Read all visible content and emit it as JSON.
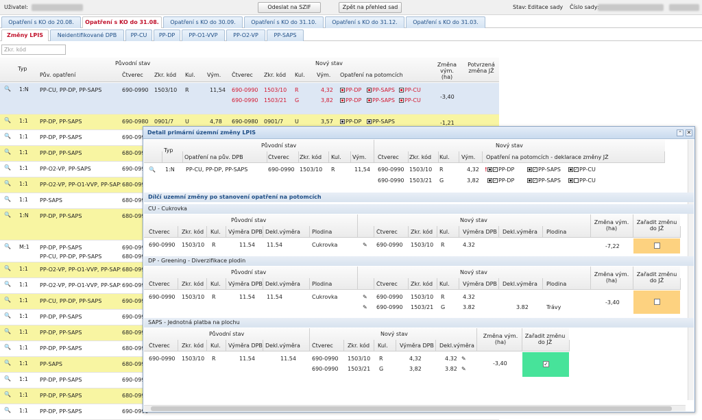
{
  "topbar": {
    "user_label": "Uživatel:",
    "send_button": "Odeslat na SZIF",
    "back_button": "Zpět na přehled sad",
    "state_label": "Stav:",
    "state_value": "Editace sady",
    "set_label": "Číslo sady:"
  },
  "tabs_top": [
    "Opatření s KO do 20.08.",
    "Opatření s KO do 31.08.",
    "Opatření s KO do 30.09.",
    "Opatření s KO do 31.10.",
    "Opatření s KO do 31.12.",
    "Opatření s KO do 31.03."
  ],
  "tabs_sub": [
    "Změny LPIS",
    "Neidentifikované DPB",
    "PP-CU",
    "PP-DP",
    "PP-O1-VVP",
    "PP-O2-VP",
    "PP-SAPS"
  ],
  "filter_placeholder": "Zkr. kód",
  "grid": {
    "headers": {
      "typ": "Typ",
      "puvodni": "Původní stav",
      "novy": "Nový stav",
      "zmena": "Změna vým. (ha)",
      "potvrzena": "Potvrzená změna JŽ",
      "puv_opatreni": "Pův. opatření",
      "ctverec": "Čtverec",
      "zkr": "Zkr. kód",
      "kul": "Kul.",
      "vym": "Vým.",
      "ctverec2": "Čtverec",
      "zkr2": "Zkr. kód",
      "kul2": "Kul.",
      "vym2": "Vým.",
      "op_potomci": "Opatření na potomcích"
    },
    "rows": [
      {
        "typ": "1:N",
        "opat": "PP-CU, PP-DP, PP-SAPS",
        "ctv": "690-0990",
        "zkr": "1503/10",
        "kul": "R",
        "vym": "11,54",
        "new": [
          [
            "690-0990",
            "1503/10",
            "R",
            "4,32"
          ],
          [
            "690-0990",
            "1503/21",
            "G",
            "3,82"
          ]
        ],
        "pot": [
          [
            "PP-DP",
            "PP-SAPS",
            "PP-CU"
          ],
          [
            "PP-DP",
            "PP-SAPS",
            "PP-CU"
          ]
        ],
        "zmena": "-3,40"
      },
      {
        "typ": "1:1",
        "opat": "PP-DP, PP-SAPS",
        "ctv": "690-0980",
        "zkr": "0901/7",
        "kul": "U",
        "vym": "4,78",
        "new": [
          [
            "690-0980",
            "0901/7",
            "U",
            "3,57"
          ]
        ],
        "pot": [
          [
            "PP-DP",
            "PP-SAPS"
          ]
        ],
        "zmena": "-1,21"
      },
      {
        "typ": "1:1",
        "opat": "PP-DP, PP-SAPS",
        "ctv": "690-0990"
      },
      {
        "typ": "1:1",
        "opat": "PP-DP, PP-SAPS",
        "ctv": "680-0990"
      },
      {
        "typ": "1:1",
        "opat": "PP-O2-VP, PP-SAPS",
        "ctv": "690-0990"
      },
      {
        "typ": "1:1",
        "opat": "PP-O2-VP, PP-O1-VVP, PP-SAPS",
        "ctv": "680-0990"
      },
      {
        "typ": "1:1",
        "opat": "PP-SAPS",
        "ctv": "680-0990"
      },
      {
        "typ": "1:N",
        "opat": "PP-DP, PP-SAPS",
        "ctv": "680-0990"
      },
      {
        "typ": "M:1",
        "opat": "PP-DP, PP-SAPS",
        "opat2": "PP-CU, PP-DP, PP-SAPS",
        "ctv": "690-0990",
        "ctv2": "680-0990"
      },
      {
        "typ": "1:1",
        "opat": "PP-O2-VP, PP-O1-VVP, PP-SAPS",
        "ctv": "680-0990"
      },
      {
        "typ": "1:1",
        "opat": "PP-O2-VP, PP-O1-VVP, PP-SAPS",
        "ctv": "690-0990"
      },
      {
        "typ": "1:1",
        "opat": "PP-CU, PP-DP, PP-SAPS",
        "ctv": "690-0990"
      },
      {
        "typ": "1:1",
        "opat": "PP-DP, PP-SAPS",
        "ctv": "690-0990"
      },
      {
        "typ": "1:1",
        "opat": "PP-DP, PP-SAPS",
        "ctv": "680-0990"
      },
      {
        "typ": "1:1",
        "opat": "PP-DP, PP-SAPS",
        "ctv": "680-0990"
      },
      {
        "typ": "1:1",
        "opat": "PP-SAPS",
        "ctv": "680-0990"
      },
      {
        "typ": "1:1",
        "opat": "PP-DP, PP-SAPS",
        "ctv": "690-0990"
      },
      {
        "typ": "1:1",
        "opat": "PP-DP, PP-SAPS",
        "ctv": "680-0990"
      },
      {
        "typ": "1:1",
        "opat": "PP-DP, PP-SAPS",
        "ctv": "690-0990"
      }
    ]
  },
  "detail": {
    "title": "Detail primární územní změny LPIS",
    "head": {
      "typ": "Typ",
      "puvodni": "Původní stav",
      "novy": "Nový stav",
      "op_dpb": "Opatření na pův. DPB",
      "ctverec": "Čtverec",
      "zkr": "Zkr. kód",
      "kul": "Kul.",
      "vym": "Vým.",
      "op_pot": "Opatření na potomcích - deklarace změny JŽ"
    },
    "row": {
      "typ": "1:N",
      "opat": "PP-CU, PP-DP, PP-SAPS",
      "ctv": "690-0990",
      "zkr": "1503/10",
      "kul": "R",
      "vym": "11,54",
      "n1": [
        "690-0990",
        "1503/10",
        "R",
        "4,32"
      ],
      "n2": [
        "690-0990",
        "1503/21",
        "G",
        "3,82"
      ],
      "p1": [
        "PP-DP",
        "PP-SAPS",
        "PP-CU"
      ],
      "p2": [
        "PP-DP",
        "PP-SAPS",
        "PP-CU"
      ]
    },
    "subtitle": "Dílčí uzemní změny po stanovení opatření na potomcích",
    "sections": [
      {
        "name": "CU - Cukrovka",
        "zmena": "-7,22",
        "rows": [
          [
            "690-0990",
            "1503/10",
            "R",
            "11.54",
            "11.54",
            "Cukrovka"
          ]
        ],
        "new": [
          [
            "690-0990",
            "1503/10",
            "R",
            "4.32",
            "",
            ""
          ]
        ]
      },
      {
        "name": "DP - Greening - Diverzifikace plodin",
        "zmena": "-3,40",
        "rows": [
          [
            "690-0990",
            "1503/10",
            "R",
            "11.54",
            "11.54",
            "Cukrovka"
          ]
        ],
        "new": [
          [
            "690-0990",
            "1503/10",
            "R",
            "4.32",
            "",
            ""
          ],
          [
            "690-0990",
            "1503/21",
            "G",
            "3.82",
            "3.82",
            "Trávy"
          ]
        ]
      },
      {
        "name": "SAPS - Jednotná platba na plochu",
        "zmena": "-3,40",
        "rows": [
          [
            "690-0990",
            "1503/10",
            "R",
            "11.54",
            "11.54"
          ]
        ],
        "new": [
          [
            "690-0990",
            "1503/10",
            "R",
            "4,32",
            "4.32"
          ],
          [
            "690-0990",
            "1503/21",
            "G",
            "3,82",
            "3.82"
          ]
        ]
      }
    ],
    "cols": {
      "ctverec": "Čtverec",
      "zkr": "Zkr. kód",
      "kul": "Kul.",
      "vym_dpb": "Výměra DPB",
      "dekl": "Dekl.výměra",
      "plodina": "Plodina",
      "zmena": "Změna vým. (ha)",
      "zaradit": "Zařadit změnu do JŽ",
      "puvodni": "Původní stav",
      "novy": "Nový stav"
    }
  },
  "colors": {
    "accent_red": "#d3172f",
    "yellow_row": "#f8f5a2",
    "blue_row": "#dde7f4",
    "orange_cell": "#fdd280",
    "green_cell": "#47e39a"
  }
}
